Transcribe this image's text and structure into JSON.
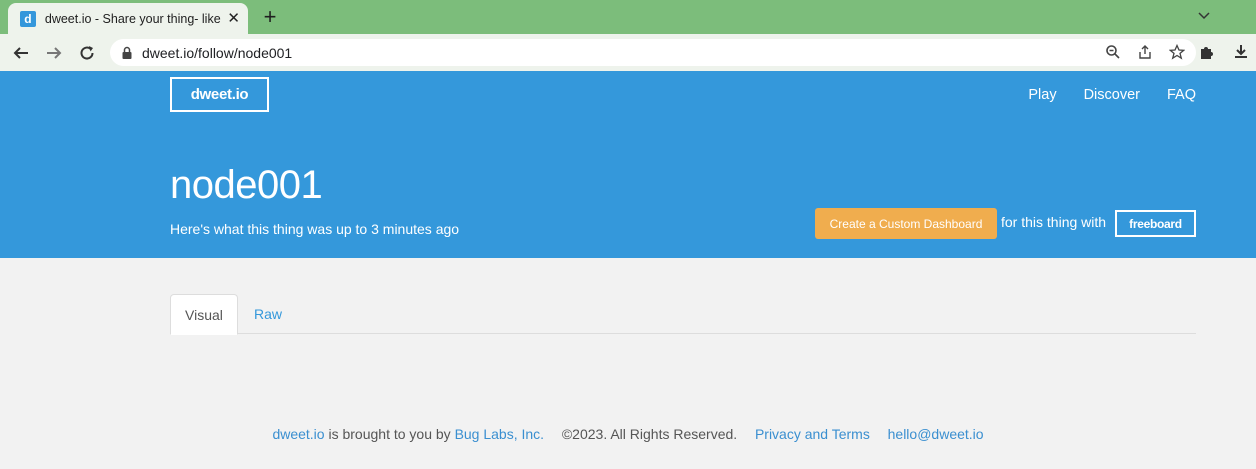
{
  "browser": {
    "tab_title": "dweet.io - Share your thing- like",
    "tab_favicon_letter": "d",
    "url": "dweet.io/follow/node001"
  },
  "header": {
    "logo": "dweet.io",
    "nav": [
      "Play",
      "Discover",
      "FAQ"
    ]
  },
  "hero": {
    "thing_name": "node001",
    "subtitle": "Here's what this thing was up to 3 minutes ago",
    "dashboard_button": "Create a Custom Dashboard",
    "dashboard_text": "for this thing with",
    "freeboard_label": "freeboard"
  },
  "content_tabs": [
    "Visual",
    "Raw"
  ],
  "footer": {
    "brand_link": "dweet.io",
    "brought_text": "is brought to you by",
    "company_link": "Bug Labs, Inc.",
    "copyright": "©2023. All Rights Reserved.",
    "privacy_link": "Privacy and Terms",
    "email_link": "hello@dweet.io"
  },
  "colors": {
    "hero_blue": "#3498db",
    "tab_strip_green": "#7cbd7b",
    "button_orange": "#f0ad4e"
  }
}
